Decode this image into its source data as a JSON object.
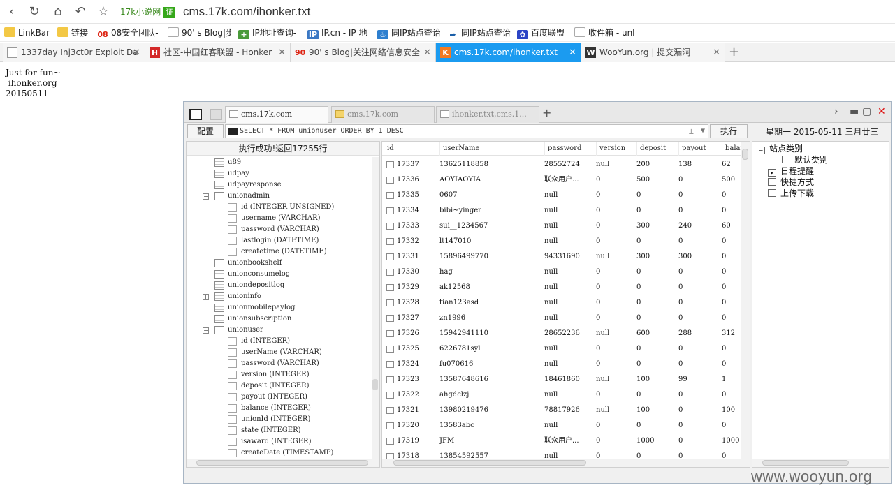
{
  "browser": {
    "site_name": "17k小说网",
    "verified_badge": "证",
    "url": "cms.17k.com/ihonker.txt",
    "bookmarks": [
      {
        "label": "LinkBar",
        "icon": "folder-icon"
      },
      {
        "label": "链接",
        "icon": "folder-icon"
      },
      {
        "label": "08安全团队-",
        "icon": "08-icon"
      },
      {
        "label": "90' s Blog|步",
        "icon": "page-icon"
      },
      {
        "label": "IP地址查询-",
        "icon": "ip-icon"
      },
      {
        "label": "IP.cn - IP 地",
        "icon": "ipcn-icon"
      },
      {
        "label": "同IP站点查诒",
        "icon": "sameip-icon"
      },
      {
        "label": "同IP站点查诒",
        "icon": "sameip2-icon"
      },
      {
        "label": "百度联盟",
        "icon": "baidu-icon"
      },
      {
        "label": "收件箱 - unl",
        "icon": "page-icon"
      }
    ],
    "tabs": [
      {
        "label": "1337day Inj3ct0r Exploit Da"
      },
      {
        "label": "社区-中国红客联盟 - Honker"
      },
      {
        "label": "90' s Blog|关注网络信息安全"
      },
      {
        "label": "cms.17k.com/ihonker.txt"
      },
      {
        "label": "WooYun.org | 提交漏洞"
      }
    ],
    "new_tab": "+"
  },
  "page": {
    "text": "Just for fun~\n ihonker.org\n20150511"
  },
  "tool": {
    "tabs": [
      {
        "label": "cms.17k.com"
      },
      {
        "label": "cms.17k.com"
      },
      {
        "label": "ihonker.txt,cms.1..."
      }
    ],
    "add_tab": "+",
    "config_label": "配置",
    "sql": "SELECT * FROM unionuser ORDER BY 1 DESC",
    "sql_plusminus": "±",
    "execute_label": "执行",
    "date_text": "星期一 2015-05-11 三月廿三",
    "status": "执行成功!返回17255行",
    "tree": [
      {
        "type": "table",
        "label": "u89",
        "expander": ""
      },
      {
        "type": "table",
        "label": "udpay",
        "expander": ""
      },
      {
        "type": "table",
        "label": "udpayresponse",
        "expander": ""
      },
      {
        "type": "table",
        "label": "unionadmin",
        "expander": "−"
      },
      {
        "type": "column",
        "label": "id (INTEGER UNSIGNED)"
      },
      {
        "type": "column",
        "label": "username (VARCHAR)"
      },
      {
        "type": "column",
        "label": "password (VARCHAR)"
      },
      {
        "type": "column",
        "label": "lastlogin (DATETIME)"
      },
      {
        "type": "column",
        "label": "createtime (DATETIME)"
      },
      {
        "type": "table",
        "label": "unionbookshelf",
        "expander": ""
      },
      {
        "type": "table",
        "label": "unionconsumelog",
        "expander": ""
      },
      {
        "type": "table",
        "label": "uniondepositlog",
        "expander": ""
      },
      {
        "type": "table",
        "label": "unioninfo",
        "expander": "+"
      },
      {
        "type": "table",
        "label": "unionmobilepaylog",
        "expander": ""
      },
      {
        "type": "table",
        "label": "unionsubscription",
        "expander": ""
      },
      {
        "type": "table",
        "label": "unionuser",
        "expander": "−"
      },
      {
        "type": "column",
        "label": "id (INTEGER)"
      },
      {
        "type": "column",
        "label": "userName (VARCHAR)"
      },
      {
        "type": "column",
        "label": "password (VARCHAR)"
      },
      {
        "type": "column",
        "label": "version (INTEGER)"
      },
      {
        "type": "column",
        "label": "deposit (INTEGER)"
      },
      {
        "type": "column",
        "label": "payout (INTEGER)"
      },
      {
        "type": "column",
        "label": "balance (INTEGER)"
      },
      {
        "type": "column",
        "label": "unionId (INTEGER)"
      },
      {
        "type": "column",
        "label": "state (INTEGER)"
      },
      {
        "type": "column",
        "label": "isaward (INTEGER)"
      },
      {
        "type": "column",
        "label": "createDate (TIMESTAMP)"
      }
    ],
    "columns": [
      "id",
      "userName",
      "password",
      "version",
      "deposit",
      "payout",
      "balar"
    ],
    "rows": [
      [
        "17337",
        "13625118858",
        "28552724",
        "null",
        "200",
        "138",
        "62"
      ],
      [
        "17336",
        "AOYIAOYIA",
        "联众用户...",
        "0",
        "500",
        "0",
        "500"
      ],
      [
        "17335",
        "0607",
        "null",
        "0",
        "0",
        "0",
        "0"
      ],
      [
        "17334",
        "bibi~yinger",
        "null",
        "0",
        "0",
        "0",
        "0"
      ],
      [
        "17333",
        "sui__1234567",
        "null",
        "0",
        "300",
        "240",
        "60"
      ],
      [
        "17332",
        "lt147010",
        "null",
        "0",
        "0",
        "0",
        "0"
      ],
      [
        "17331",
        "15896499770",
        "94331690",
        "null",
        "300",
        "300",
        "0"
      ],
      [
        "17330",
        "hag",
        "null",
        "0",
        "0",
        "0",
        "0"
      ],
      [
        "17329",
        "ak12568",
        "null",
        "0",
        "0",
        "0",
        "0"
      ],
      [
        "17328",
        "tian123asd",
        "null",
        "0",
        "0",
        "0",
        "0"
      ],
      [
        "17327",
        "zn1996",
        "null",
        "0",
        "0",
        "0",
        "0"
      ],
      [
        "17326",
        "15942941110",
        "28652236",
        "null",
        "600",
        "288",
        "312"
      ],
      [
        "17325",
        "6226781syl",
        "null",
        "0",
        "0",
        "0",
        "0"
      ],
      [
        "17324",
        "fu070616",
        "null",
        "0",
        "0",
        "0",
        "0"
      ],
      [
        "17323",
        "13587648616",
        "18461860",
        "null",
        "100",
        "99",
        "1"
      ],
      [
        "17322",
        "ahgdclzj",
        "null",
        "0",
        "0",
        "0",
        "0"
      ],
      [
        "17321",
        "13980219476",
        "78817926",
        "null",
        "100",
        "0",
        "100"
      ],
      [
        "17320",
        "13583abc",
        "null",
        "0",
        "0",
        "0",
        "0"
      ],
      [
        "17319",
        "JFM",
        "联众用户...",
        "0",
        "1000",
        "0",
        "1000"
      ],
      [
        "17318",
        "13854592557",
        "null",
        "0",
        "0",
        "0",
        "0"
      ]
    ],
    "right_tree": [
      {
        "label": "站点类别",
        "icon": "minus"
      },
      {
        "label": "默认类别",
        "icon": "blank"
      },
      {
        "label": "日程提醒",
        "icon": "calendar"
      },
      {
        "label": "快捷方式",
        "icon": "doc"
      },
      {
        "label": "上传下载",
        "icon": "box"
      }
    ]
  },
  "watermark": "www.wooyun.org"
}
